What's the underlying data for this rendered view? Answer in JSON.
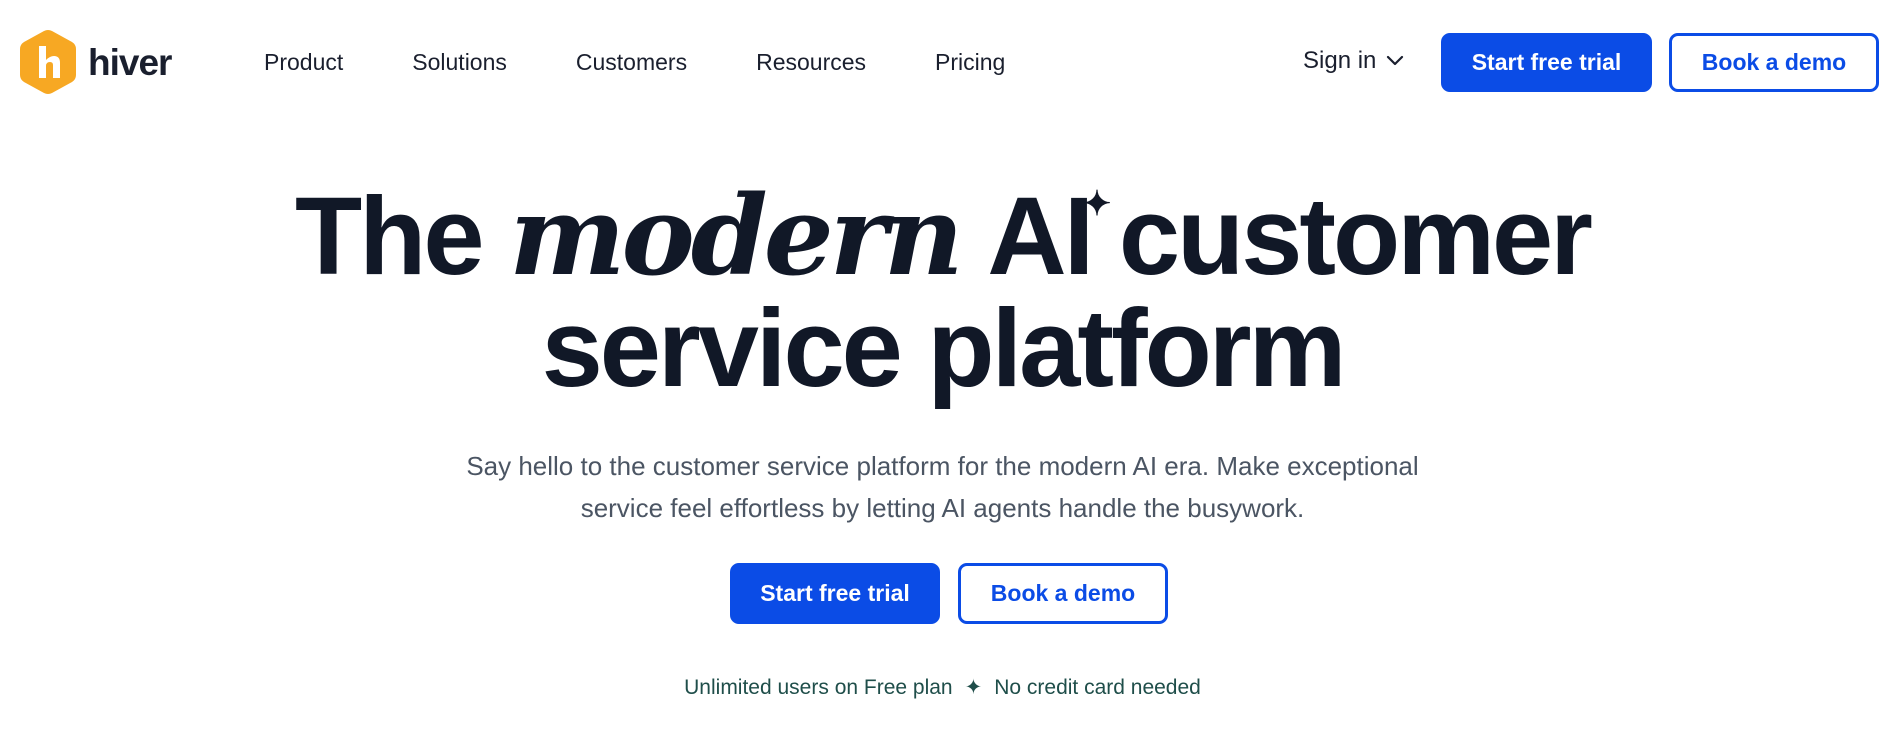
{
  "brand": {
    "name": "hiver",
    "logo_color": "#F7A823",
    "icon": "hiver-logo-icon"
  },
  "nav": {
    "items": [
      {
        "label": "Product"
      },
      {
        "label": "Solutions"
      },
      {
        "label": "Customers"
      },
      {
        "label": "Resources"
      },
      {
        "label": "Pricing"
      }
    ],
    "signin_label": "Sign in",
    "signin_icon": "chevron-down-icon",
    "trial_label": "Start free trial",
    "demo_label": "Book a demo"
  },
  "hero": {
    "title_part1": "The",
    "title_em": "modern",
    "title_part2": "AI",
    "title_part3": "customer",
    "title_line2": "service platform",
    "sparkle": "✦",
    "subtitle_line1": "Say hello to the customer service platform for the modern AI era. Make exceptional",
    "subtitle_line2": "service feel effortless by letting AI agents handle the busywork.",
    "trial_label": "Start free trial",
    "demo_label": "Book a demo",
    "note_left": "Unlimited users on Free plan",
    "note_separator": "✦",
    "note_right": "No credit card needed"
  },
  "colors": {
    "primary": "#0B4CE6",
    "text": "#111827",
    "muted": "#4B5563",
    "note": "#1F4E4A"
  }
}
